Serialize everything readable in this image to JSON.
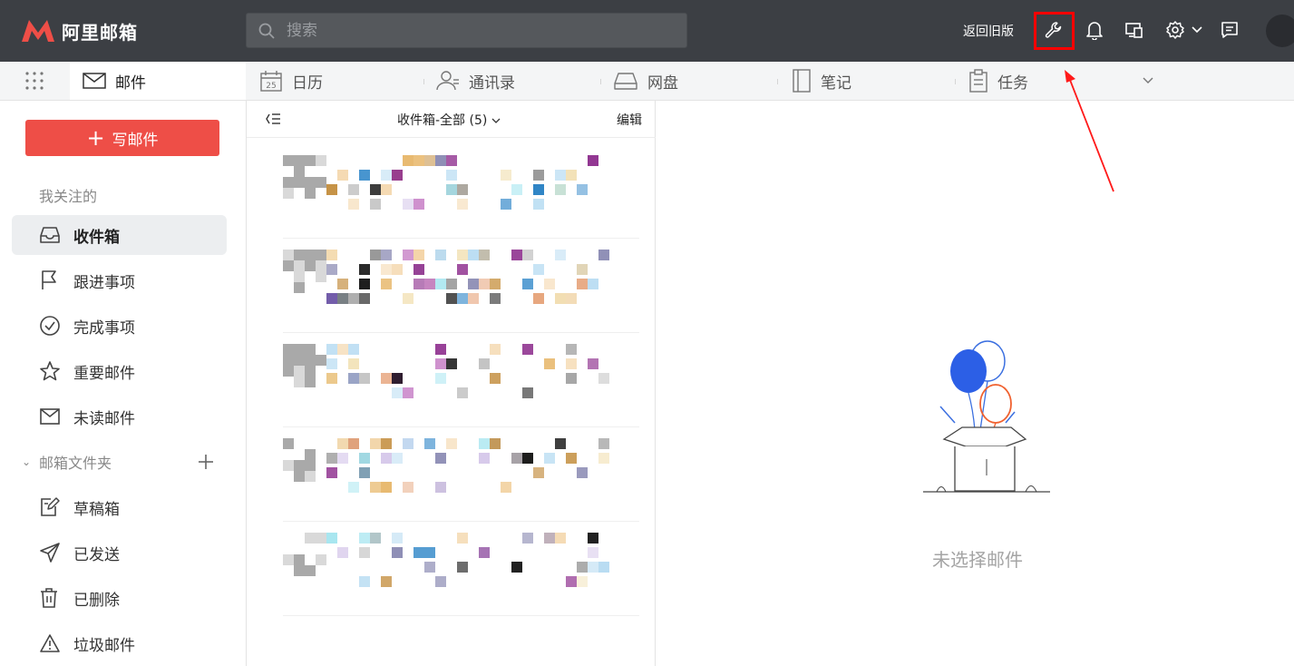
{
  "app": {
    "name": "阿里邮箱",
    "brand_color": "#ee4e47"
  },
  "topbar": {
    "search_placeholder": "搜索",
    "old_version_link": "返回旧版",
    "icons": [
      "wrench-icon",
      "bell-icon",
      "devices-icon",
      "settings-icon",
      "chevron-down-icon",
      "feedback-icon"
    ]
  },
  "tabs": [
    {
      "label": "邮件",
      "icon": "mail-icon",
      "active": true
    },
    {
      "label": "日历",
      "icon": "calendar-icon",
      "badge": "25"
    },
    {
      "label": "通讯录",
      "icon": "contacts-icon"
    },
    {
      "label": "网盘",
      "icon": "disk-icon"
    },
    {
      "label": "笔记",
      "icon": "notebook-icon"
    },
    {
      "label": "任务",
      "icon": "clipboard-icon"
    }
  ],
  "sidebar": {
    "compose_label": "写邮件",
    "followed_section": "我关注的",
    "items": [
      {
        "label": "收件箱",
        "icon": "inbox-icon",
        "active": true
      },
      {
        "label": "跟进事项",
        "icon": "flag-icon"
      },
      {
        "label": "完成事项",
        "icon": "check-circle-icon"
      },
      {
        "label": "重要邮件",
        "icon": "star-icon"
      },
      {
        "label": "未读邮件",
        "icon": "envelope-icon"
      }
    ],
    "folders_section": "邮箱文件夹",
    "folders": [
      {
        "label": "草稿箱",
        "icon": "draft-icon"
      },
      {
        "label": "已发送",
        "icon": "send-icon"
      },
      {
        "label": "已删除",
        "icon": "trash-icon"
      },
      {
        "label": "垃圾邮件",
        "icon": "warning-icon"
      }
    ]
  },
  "message_list": {
    "folder_title": "收件箱-全部 (5)",
    "edit_label": "编辑",
    "message_count": 5
  },
  "reader": {
    "empty_text": "未选择邮件"
  },
  "annotation": {
    "highlight_color": "#ff0000"
  }
}
